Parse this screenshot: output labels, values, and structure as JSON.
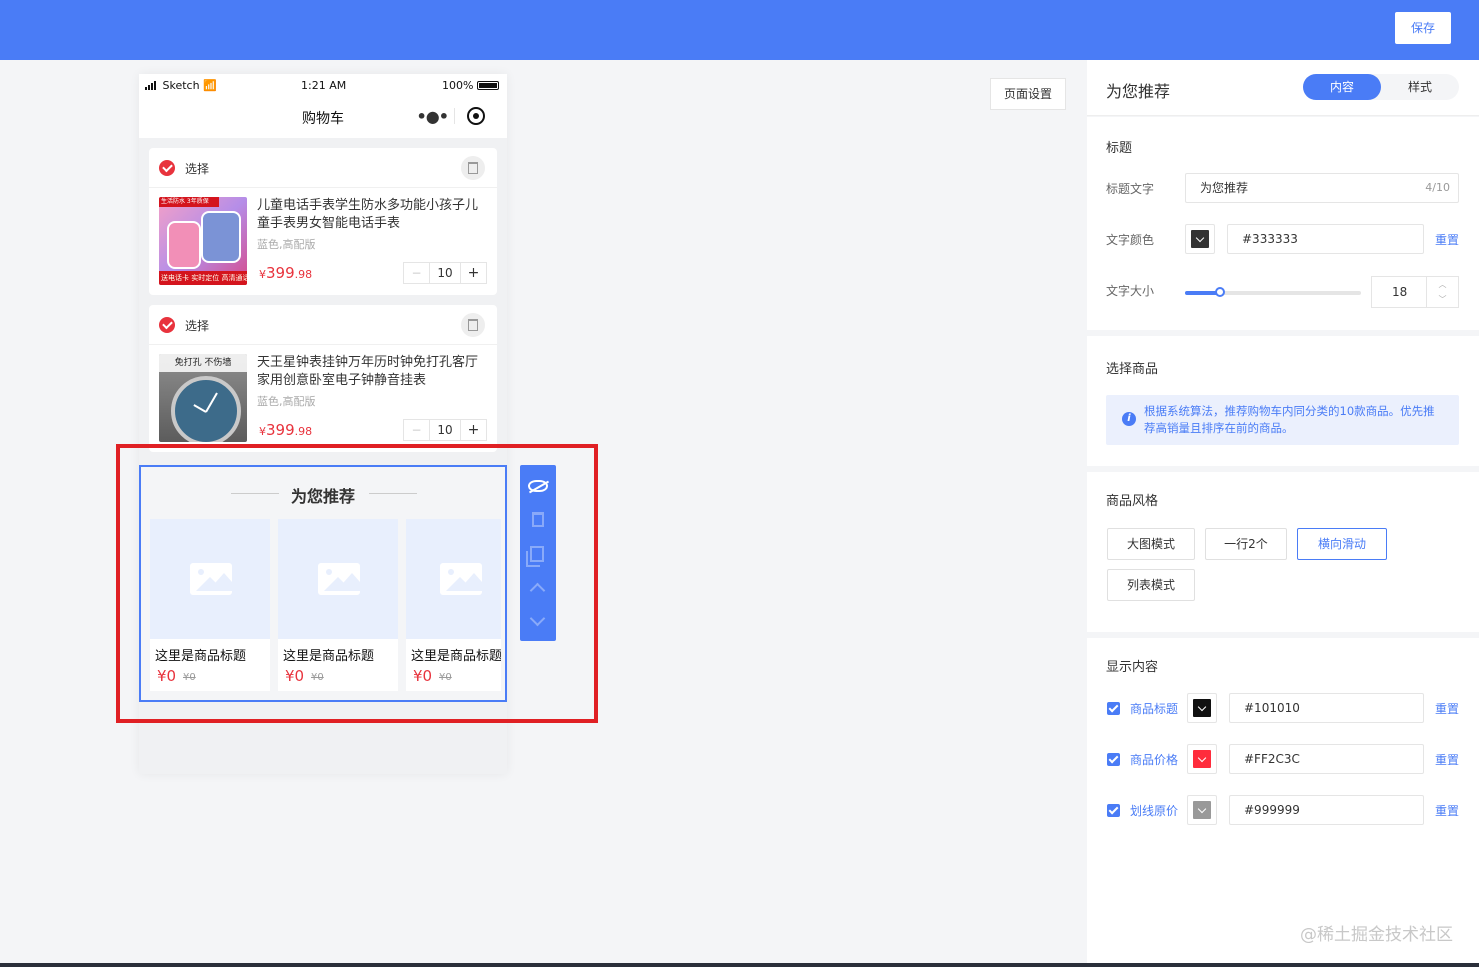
{
  "header": {
    "save_label": "保存"
  },
  "canvas": {
    "page_settings_label": "页面设置"
  },
  "phone": {
    "status": {
      "carrier": "Sketch",
      "time": "1:21 AM",
      "battery": "100%"
    },
    "nav_title": "购物车",
    "cart_items": [
      {
        "select_label": "选择",
        "title": "儿童电话手表学生防水多功能小孩子儿童手表男女智能电话手表",
        "spec": "蓝色,高配版",
        "currency": "¥",
        "price_int": "399",
        "price_dec": ".98",
        "quantity": "10",
        "minus": "−",
        "plus": "+",
        "image_ribbon": "生活防水 3年质保",
        "image_tag": "送电话卡  实时定位  高清通话"
      },
      {
        "select_label": "选择",
        "title": "天王星钟表挂钟万年历时钟免打孔客厅家用创意卧室电子钟静音挂表",
        "spec": "蓝色,高配版",
        "currency": "¥",
        "price_int": "399",
        "price_dec": ".98",
        "quantity": "10",
        "minus": "−",
        "plus": "+",
        "image_text": "免打孔 不伤墙"
      }
    ],
    "recommend": {
      "title": "为您推荐",
      "items": [
        {
          "name": "这里是商品标题",
          "price": "¥0",
          "original_price": "¥0"
        },
        {
          "name": "这里是商品标题",
          "price": "¥0",
          "original_price": "¥0"
        },
        {
          "name": "这里是商品标题",
          "price": "¥0",
          "original_price": "¥0"
        }
      ]
    }
  },
  "panel": {
    "title": "为您推荐",
    "tabs": [
      {
        "label": "内容",
        "active": true
      },
      {
        "label": "样式",
        "active": false
      }
    ],
    "heading_section": {
      "title": "标题",
      "title_text_label": "标题文字",
      "title_text_value": "为您推荐",
      "title_text_counter": "4/10",
      "text_color_label": "文字颜色",
      "text_color_value": "#333333",
      "text_color_reset": "重置",
      "text_size_label": "文字大小",
      "text_size_value": "18",
      "text_size_fraction": 0.2
    },
    "goods_section": {
      "title": "选择商品",
      "info": "根据系统算法，推荐购物车内同分类的10款商品。优先推荐高销量且排序在前的商品。"
    },
    "style_section": {
      "title": "商品风格",
      "options": [
        {
          "label": "大图模式",
          "active": false
        },
        {
          "label": "一行2个",
          "active": false
        },
        {
          "label": "横向滑动",
          "active": true
        },
        {
          "label": "列表模式",
          "active": false
        }
      ]
    },
    "display_section": {
      "title": "显示内容",
      "rows": [
        {
          "label": "商品标题",
          "checked": true,
          "color": "#101010",
          "value": "#101010",
          "reset": "重置"
        },
        {
          "label": "商品价格",
          "checked": true,
          "color": "#FF2C3C",
          "value": "#FF2C3C",
          "reset": "重置"
        },
        {
          "label": "划线原价",
          "checked": true,
          "color": "#999999",
          "value": "#999999",
          "reset": "重置"
        }
      ]
    }
  },
  "watermark": "@稀土掘金技术社区",
  "colors": {
    "brand": "#4a7cf6",
    "price_red": "#e8333d",
    "highlight_box": "#e02024"
  }
}
